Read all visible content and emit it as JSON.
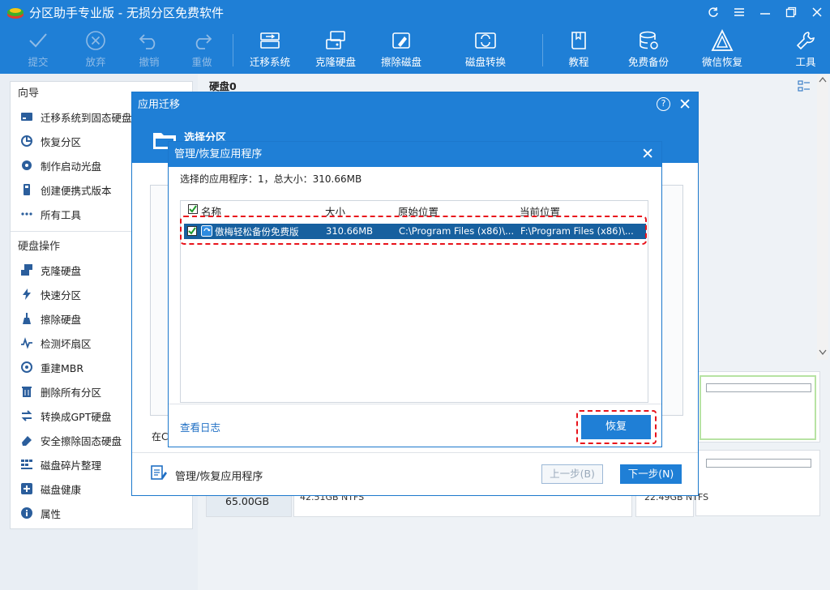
{
  "app": {
    "title": "分区助手专业版 - 无损分区免费软件"
  },
  "window_controls": [
    "refresh-icon",
    "menu-icon",
    "minimize-icon",
    "maximize-icon",
    "close-icon"
  ],
  "toolbar": {
    "items": [
      {
        "label": "提交",
        "icon": "check-icon",
        "enabled": false
      },
      {
        "label": "放弃",
        "icon": "x-circle-icon",
        "enabled": false
      },
      {
        "label": "撤销",
        "icon": "undo-icon",
        "enabled": false
      },
      {
        "label": "重做",
        "icon": "redo-icon",
        "enabled": false
      },
      {
        "label": "迁移系统",
        "icon": "migrate-icon",
        "enabled": true
      },
      {
        "label": "克隆硬盘",
        "icon": "clone-icon",
        "enabled": true
      },
      {
        "label": "擦除磁盘",
        "icon": "wipe-icon",
        "enabled": true
      },
      {
        "label": "磁盘转换",
        "icon": "convert-icon",
        "enabled": true
      },
      {
        "label": "教程",
        "icon": "book-icon",
        "enabled": true
      },
      {
        "label": "免费备份",
        "icon": "backup-icon",
        "enabled": true
      },
      {
        "label": "微信恢复",
        "icon": "recover-icon",
        "enabled": true
      },
      {
        "label": "工具",
        "icon": "wrench-icon",
        "enabled": true
      }
    ]
  },
  "sidebar": {
    "wizard_title": "向导",
    "wizard_items": [
      {
        "label": "迁移系统到固态硬盘",
        "icon": "ssd-icon"
      },
      {
        "label": "恢复分区",
        "icon": "restore-partition-icon"
      },
      {
        "label": "制作启动光盘",
        "icon": "boot-disc-icon"
      },
      {
        "label": "创建便携式版本",
        "icon": "portable-icon"
      },
      {
        "label": "所有工具",
        "icon": "dots-icon"
      }
    ],
    "disk_ops_title": "硬盘操作",
    "disk_ops_items": [
      {
        "label": "克隆硬盘",
        "icon": "clone-disk-icon"
      },
      {
        "label": "快速分区",
        "icon": "lightning-icon"
      },
      {
        "label": "擦除硬盘",
        "icon": "broom-icon"
      },
      {
        "label": "检测坏扇区",
        "icon": "scan-icon"
      },
      {
        "label": "重建MBR",
        "icon": "mbr-icon"
      },
      {
        "label": "删除所有分区",
        "icon": "trash-icon"
      },
      {
        "label": "转换成GPT硬盘",
        "icon": "gpt-convert-icon"
      },
      {
        "label": "安全擦除固态硬盘",
        "icon": "eraser-icon"
      },
      {
        "label": "磁盘碎片整理",
        "icon": "defrag-icon"
      },
      {
        "label": "磁盘健康",
        "icon": "health-icon"
      },
      {
        "label": "属性",
        "icon": "info-icon"
      }
    ]
  },
  "main": {
    "disk_header": "硬盘0",
    "disk_size": "65.00GB",
    "partition_fs_left": "42.51GB NTFS",
    "partition_fs_right": "22.49GB NTFS"
  },
  "dialog_migrate": {
    "title": "应用迁移",
    "step_title": "选择分区",
    "background_text": "在C:",
    "footer_label": "管理/恢复应用程序",
    "prev_button": "上一步(B)",
    "next_button": "下一步(N)"
  },
  "dialog_manage": {
    "title": "管理/恢复应用程序",
    "summary": "选择的应用程序：1，总大小：310.66MB",
    "columns": {
      "name": "名称",
      "size": "大小",
      "original": "原始位置",
      "current": "当前位置"
    },
    "rows": [
      {
        "checked": true,
        "name": "傲梅轻松备份免费版",
        "size": "310.66MB",
        "original": "C:\\Program Files (x86)\\...",
        "current": "F:\\Program Files (x86)\\..."
      }
    ],
    "view_log_link": "查看日志",
    "restore_button": "恢复"
  },
  "colors": {
    "accent": "#1f7fd6",
    "highlight_dash": "#e8131b",
    "selected_row": "#17609f"
  }
}
